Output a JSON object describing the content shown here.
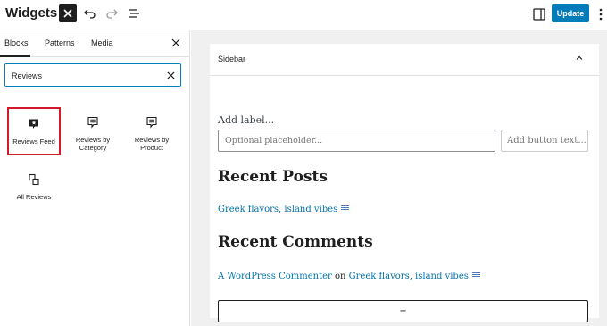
{
  "topbar": {
    "title": "Widgets",
    "update_label": "Update",
    "icons": [
      "close-icon",
      "undo-icon",
      "redo-icon",
      "list-view-icon",
      "sidebar-toggle-icon",
      "more-options-icon"
    ]
  },
  "inserter": {
    "tabs": [
      {
        "label": "Blocks",
        "active": true
      },
      {
        "label": "Patterns",
        "active": false
      },
      {
        "label": "Media",
        "active": false
      }
    ],
    "search": {
      "value": "Reviews"
    },
    "results": [
      {
        "label": "Reviews Feed",
        "icon": "star-comment-icon",
        "highlighted": true
      },
      {
        "label": "Reviews by Category",
        "icon": "comment-lines-icon",
        "highlighted": false
      },
      {
        "label": "Reviews by Product",
        "icon": "comment-lines-icon",
        "highlighted": false
      },
      {
        "label": "All Reviews",
        "icon": "reviews-list-icon",
        "highlighted": false
      }
    ]
  },
  "widget_area": {
    "title": "Sidebar",
    "search_block": {
      "label": "Add label...",
      "placeholder": "Optional placeholder...",
      "button": "Add button text..."
    },
    "recent_posts": {
      "heading": "Recent Posts",
      "items": [
        "Greek flavors, island vibes"
      ]
    },
    "recent_comments": {
      "heading": "Recent Comments",
      "author": "A WordPress Commenter",
      "connector": "on",
      "post": "Greek flavors, island vibes"
    },
    "add_block_label": "+"
  },
  "colors": {
    "accent": "#007cba",
    "highlight_border": "#d11a2a",
    "link": "#0073aa",
    "canvas_bg": "#f0f0f0"
  }
}
